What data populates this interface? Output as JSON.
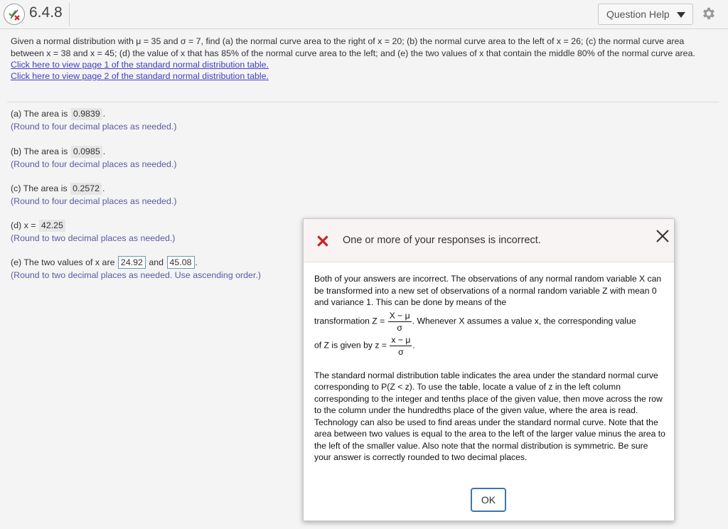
{
  "header": {
    "question_number": "6.4.8",
    "question_help_label": "Question Help"
  },
  "question": {
    "text": "Given a normal distribution with μ = 35 and σ = 7, find (a) the normal curve area to the right of x = 20; (b) the normal curve area to the left of x = 26; (c) the normal curve area between x = 38 and x = 45; (d) the value of x that has 85% of the normal curve area to the left; and (e) the two values of x that contain the middle 80% of the normal curve area.",
    "link1": "Click here to view page 1 of the standard normal distribution table.",
    "link2": "Click here to view page 2 of the standard normal distribution table."
  },
  "parts": {
    "a": {
      "prefix": "(a) The area is",
      "value": "0.9839",
      "suffix": ".",
      "hint": "(Round to four decimal places as needed.)"
    },
    "b": {
      "prefix": "(b) The area is",
      "value": "0.0985",
      "suffix": ".",
      "hint": "(Round to four decimal places as needed.)"
    },
    "c": {
      "prefix": "(c) The area is",
      "value": "0.2572",
      "suffix": ".",
      "hint": "(Round to four decimal places as needed.)"
    },
    "d": {
      "prefix": "(d) x =",
      "value": "42.25",
      "hint": "(Round to two decimal places as needed.)"
    },
    "e": {
      "prefix": "(e) The two values of x are",
      "value1": "24.92",
      "and": "and",
      "value2": "45.08",
      "suffix": ".",
      "hint": "(Round to two decimal places as needed. Use ascending order.)"
    }
  },
  "dialog": {
    "title": "One or more of your responses is incorrect.",
    "p1_start": "Both of your answers are incorrect. The observations of any normal random variable X can be transformed into a new set of observations of a normal random variable Z with mean 0 and variance 1. This can be done by means of the",
    "p1_transform": "transformation Z =",
    "frac1_num": "X − μ",
    "frac1_den": "σ",
    "p1_after": ". Whenever X assumes a value x, the corresponding value",
    "p1_ofz": "of Z is given by z =",
    "frac2_num": "x − μ",
    "frac2_den": "σ",
    "p1_end": ".",
    "p2": "The standard normal distribution table indicates the area under the standard normal curve corresponding to P(Z < z). To use the table, locate a value of z in the left column corresponding to the integer and tenths place of the given value, then move across the row to the column under the hundredths place of the given value, where the area is read. Technology can also be used to find areas under the standard normal curve. Note that the area between two values is equal to the area to the left of the larger value minus the area to the left of the smaller value. Also note that the normal distribution is symmetric. Be sure your answer is correctly rounded to two decimal places.",
    "ok_label": "OK"
  },
  "icons": {
    "status": "partially-correct-icon",
    "dropdown": "caret-down-icon",
    "settings": "gear-icon",
    "error": "red-x-icon",
    "close": "close-icon"
  },
  "colors": {
    "error_red": "#cc2222",
    "link_blue": "#4040c0",
    "ok_border": "#3a77b0"
  }
}
